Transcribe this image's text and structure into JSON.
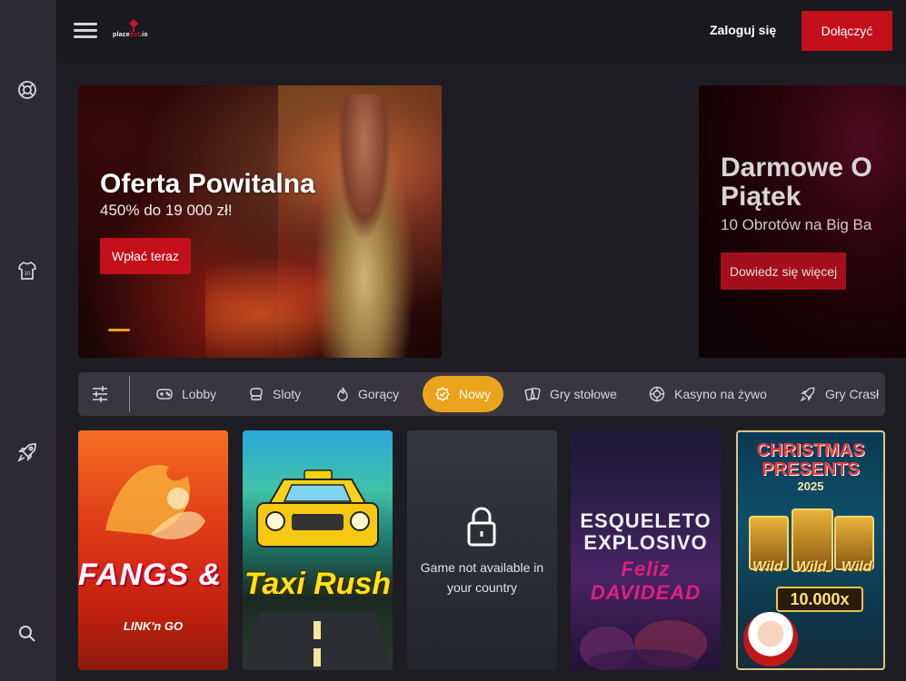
{
  "header": {
    "logo_text_1": "place",
    "logo_text_2": "bet",
    "logo_text_3": ".io",
    "login_label": "Zaloguj się",
    "join_label": "Dołączyć"
  },
  "sidebar": {
    "icons": [
      "lifebuoy-icon",
      "jersey-icon",
      "rocket-icon",
      "search-icon"
    ]
  },
  "banners": [
    {
      "title": "Oferta Powitalna",
      "subtitle": "450% do 19 000 zł!",
      "button": "Wpłać teraz"
    },
    {
      "title_line1": "Darmowe O",
      "title_line2": "Piątek",
      "subtitle": "10 Obrotów na Big Ba",
      "button": "Dowiedz się więcej"
    }
  ],
  "categories": [
    {
      "label": "Lobby",
      "icon": "gamepad-icon"
    },
    {
      "label": "Sloty",
      "icon": "slot-machine-icon"
    },
    {
      "label": "Gorący",
      "icon": "flame-icon"
    },
    {
      "label": "Nowy",
      "icon": "new-badge-icon",
      "active": true
    },
    {
      "label": "Gry stołowe",
      "icon": "cards-icon"
    },
    {
      "label": "Kasyno na żywo",
      "icon": "roulette-icon"
    },
    {
      "label": "Gry Crasł",
      "icon": "rocket-icon"
    }
  ],
  "games": {
    "fangs_title": "FANGS & FIRE",
    "fangs_sub": "LINK'n GO",
    "taxi_title": "Taxi Rush",
    "locked_message": "Game not available in your country",
    "esqueleto_title": "ESQUELETO EXPLOSIVO",
    "esqueleto_sub": "Feliz DAVIDEAD",
    "christmas_title": "CHRISTMAS PRESENTS",
    "christmas_year": "2025",
    "christmas_wild": "Wild",
    "christmas_mult": "10.000x"
  },
  "colors": {
    "accent_red": "#c4101b",
    "active_tab": "#e9a41c",
    "sidebar_bg": "#2e2a34",
    "topbar_bg": "#1a191e",
    "page_bg": "#1f1d24"
  }
}
